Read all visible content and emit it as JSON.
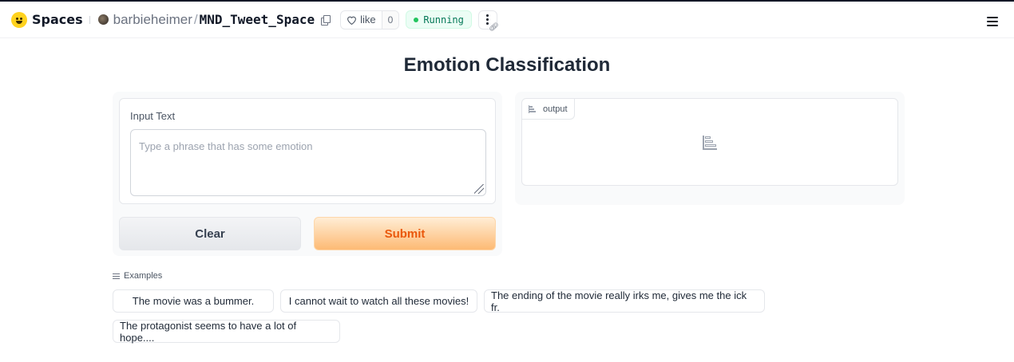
{
  "header": {
    "brand": "Spaces",
    "owner": "barbieheimer",
    "repo": "MND_Tweet_Space",
    "like_label": "like",
    "like_count": "0",
    "status": "Running"
  },
  "app": {
    "title": "Emotion Classification",
    "input_label": "Input Text",
    "input_placeholder": "Type a phrase that has some emotion",
    "input_value": "",
    "clear_label": "Clear",
    "submit_label": "Submit",
    "output_label": "output"
  },
  "examples": {
    "label": "Examples",
    "items": [
      "The movie was a bummer.",
      "I cannot wait to watch all these movies!",
      "The ending of the movie really irks me, gives me the ick fr.",
      "The protagonist seems to have a lot of hope...."
    ]
  },
  "colors": {
    "accent": "#ea580c",
    "status_green": "#22c55e"
  }
}
